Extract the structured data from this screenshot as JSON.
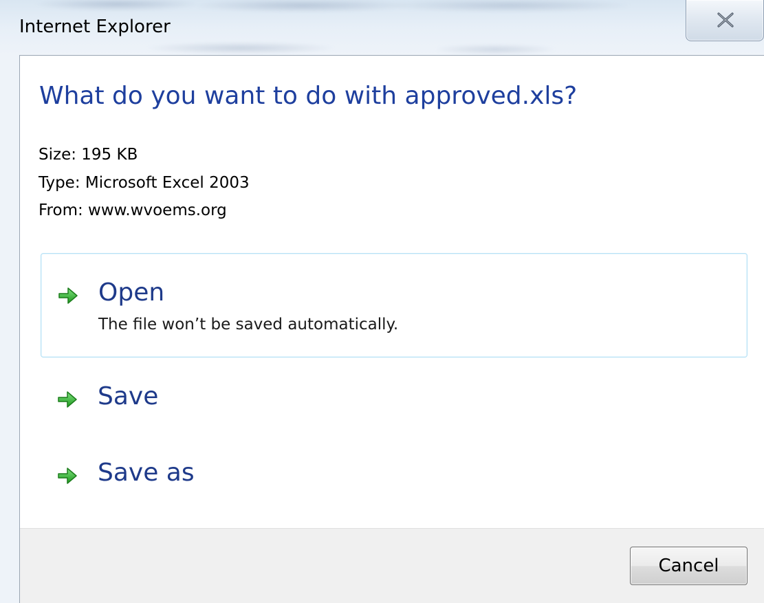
{
  "window": {
    "title": "Internet Explorer"
  },
  "dialog": {
    "question": "What do you want to do with approved.xls?",
    "size": "Size: 195 KB",
    "type": "Type: Microsoft Excel 2003",
    "from": "From: www.wvoems.org"
  },
  "commands": {
    "open_label": "Open",
    "open_desc": "The file won’t be saved automatically.",
    "save_label": "Save",
    "save_as_label": "Save as",
    "icon": "green-arrow-icon"
  },
  "footer": {
    "cancel_label": "Cancel"
  },
  "colors": {
    "accent_blue": "#1e3f9e",
    "arrow_green": "#2fb12f",
    "highlight_border": "#b5e1f5"
  }
}
